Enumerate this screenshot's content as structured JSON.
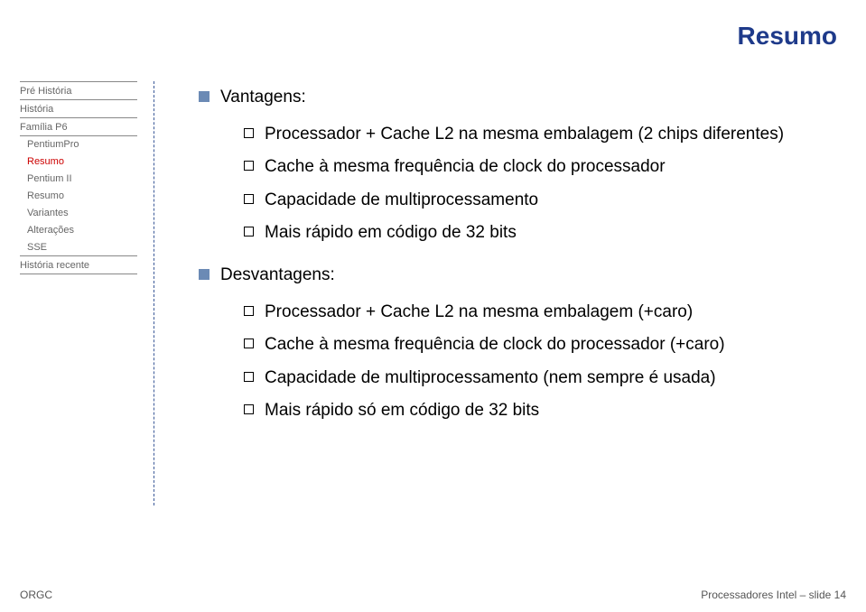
{
  "title": "Resumo",
  "sidebar": {
    "items": [
      {
        "label": "Pré História",
        "cls": "top"
      },
      {
        "label": "História",
        "cls": "top"
      },
      {
        "label": "Família P6",
        "cls": "top"
      },
      {
        "label": "PentiumPro",
        "cls": "sub"
      },
      {
        "label": "Resumo",
        "cls": "sub current"
      },
      {
        "label": "Pentium II",
        "cls": "sub"
      },
      {
        "label": "Resumo",
        "cls": "sub"
      },
      {
        "label": "Variantes",
        "cls": "sub"
      },
      {
        "label": "Alterações",
        "cls": "sub"
      },
      {
        "label": "SSE",
        "cls": "sub"
      },
      {
        "label": "História recente",
        "cls": "top"
      }
    ]
  },
  "content": {
    "vantagens_label": "Vantagens:",
    "vantagens": [
      "Processador + Cache L2 na mesma embalagem (2 chips diferentes)",
      "Cache à mesma frequência de clock do processador",
      "Capacidade de multiprocessamento",
      "Mais rápido em código de 32 bits"
    ],
    "desvantagens_label": "Desvantagens:",
    "desvantagens": [
      "Processador + Cache L2 na mesma embalagem (+caro)",
      "Cache à mesma frequência de clock do processador (+caro)",
      "Capacidade de multiprocessamento (nem sempre é usada)",
      "Mais rápido só em código de 32 bits"
    ]
  },
  "footer": {
    "left": "ORGC",
    "right": "Processadores Intel – slide 14"
  }
}
